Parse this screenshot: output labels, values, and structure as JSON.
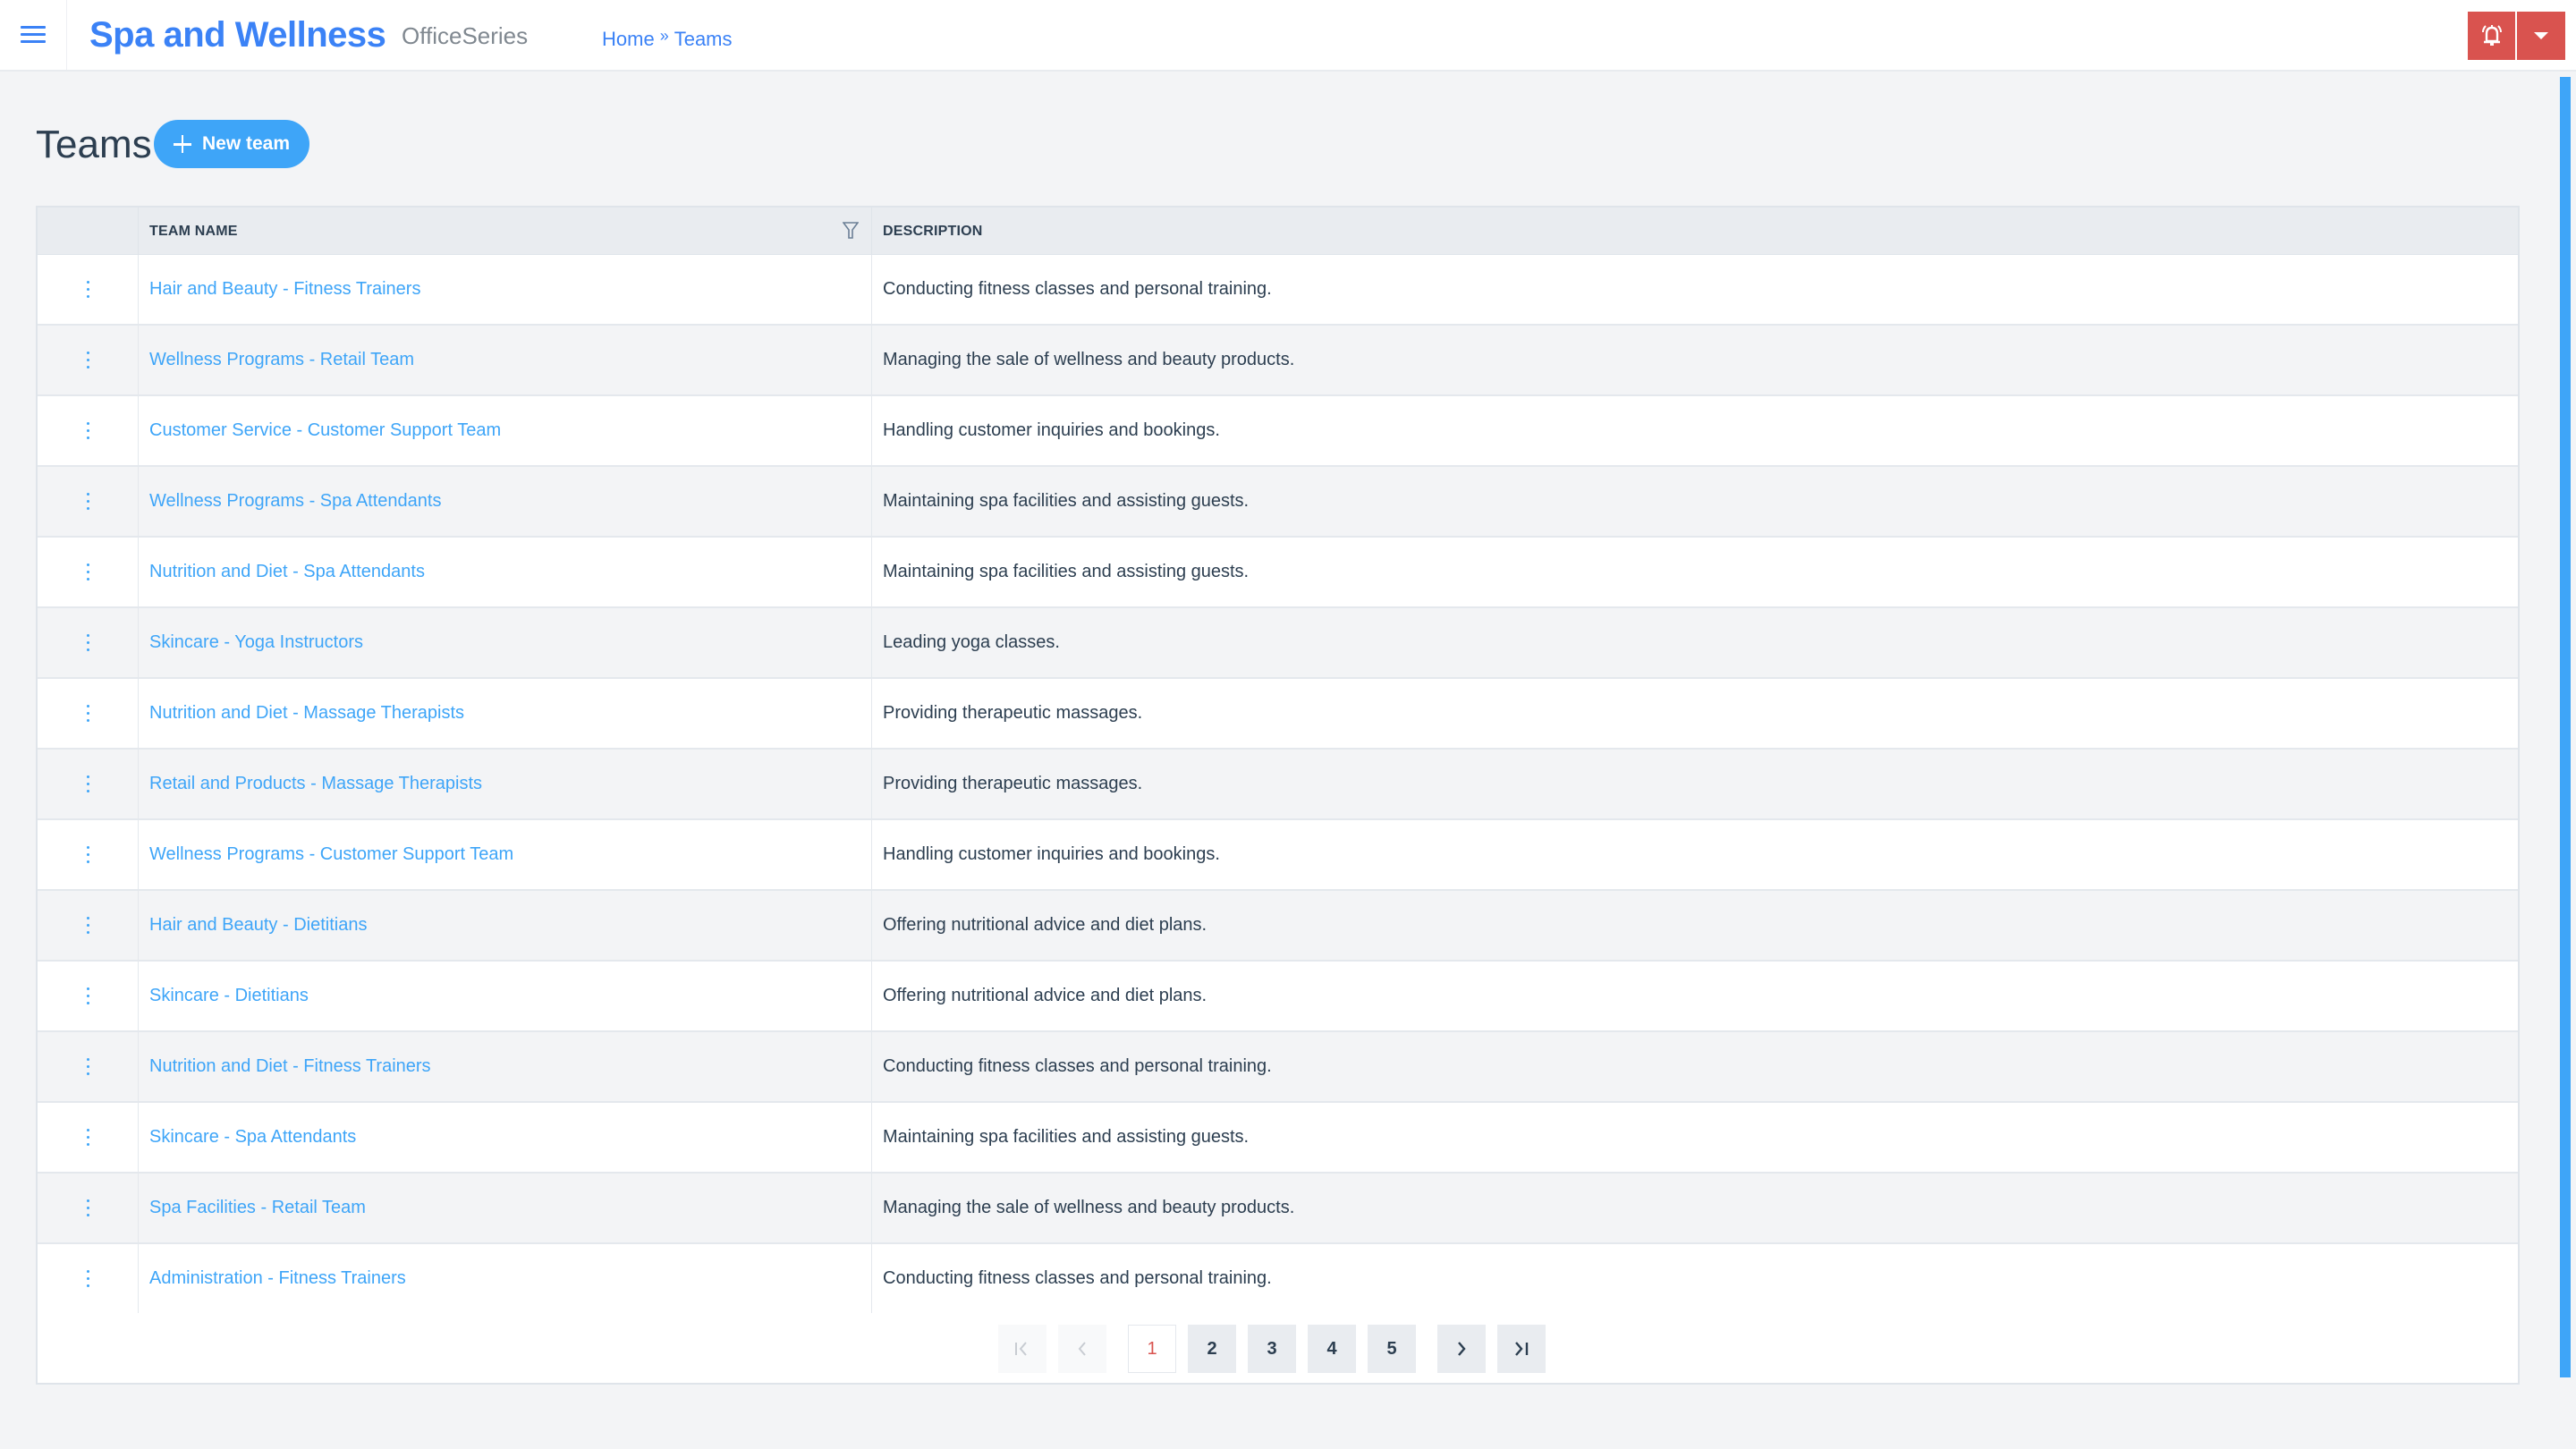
{
  "header": {
    "menu_icon": "hamburger-menu-icon",
    "app_title": "Spa and Wellness",
    "app_subtitle": "OfficeSeries",
    "breadcrumb": {
      "items": [
        "Home",
        "Teams"
      ],
      "separator": "»"
    },
    "alert_icon": "bell-alert-icon",
    "dropdown_icon": "caret-down-icon",
    "alert_color": "#d9534f"
  },
  "page": {
    "title": "Teams",
    "new_button_label": "New team",
    "accent_color": "#3ea5f8"
  },
  "table": {
    "columns": [
      "",
      "TEAM NAME",
      "DESCRIPTION"
    ],
    "rows": [
      {
        "name": "Hair and Beauty - Fitness Trainers",
        "description": "Conducting fitness classes and personal training."
      },
      {
        "name": "Wellness Programs - Retail Team",
        "description": "Managing the sale of wellness and beauty products."
      },
      {
        "name": "Customer Service - Customer Support Team",
        "description": "Handling customer inquiries and bookings."
      },
      {
        "name": "Wellness Programs - Spa Attendants",
        "description": "Maintaining spa facilities and assisting guests."
      },
      {
        "name": "Nutrition and Diet - Spa Attendants",
        "description": "Maintaining spa facilities and assisting guests."
      },
      {
        "name": "Skincare - Yoga Instructors",
        "description": "Leading yoga classes."
      },
      {
        "name": "Nutrition and Diet - Massage Therapists",
        "description": "Providing therapeutic massages."
      },
      {
        "name": "Retail and Products - Massage Therapists",
        "description": "Providing therapeutic massages."
      },
      {
        "name": "Wellness Programs - Customer Support Team",
        "description": "Handling customer inquiries and bookings."
      },
      {
        "name": "Hair and Beauty - Dietitians",
        "description": "Offering nutritional advice and diet plans."
      },
      {
        "name": "Skincare - Dietitians",
        "description": "Offering nutritional advice and diet plans."
      },
      {
        "name": "Nutrition and Diet - Fitness Trainers",
        "description": "Conducting fitness classes and personal training."
      },
      {
        "name": "Skincare - Spa Attendants",
        "description": "Maintaining spa facilities and assisting guests."
      },
      {
        "name": "Spa Facilities - Retail Team",
        "description": "Managing the sale of wellness and beauty products."
      },
      {
        "name": "Administration - Fitness Trainers",
        "description": "Conducting fitness classes and personal training."
      }
    ]
  },
  "pagination": {
    "first_label": "|<",
    "prev_label": "<",
    "pages": [
      "1",
      "2",
      "3",
      "4",
      "5"
    ],
    "current_page": "1",
    "next_label": ">",
    "last_label": ">|"
  }
}
